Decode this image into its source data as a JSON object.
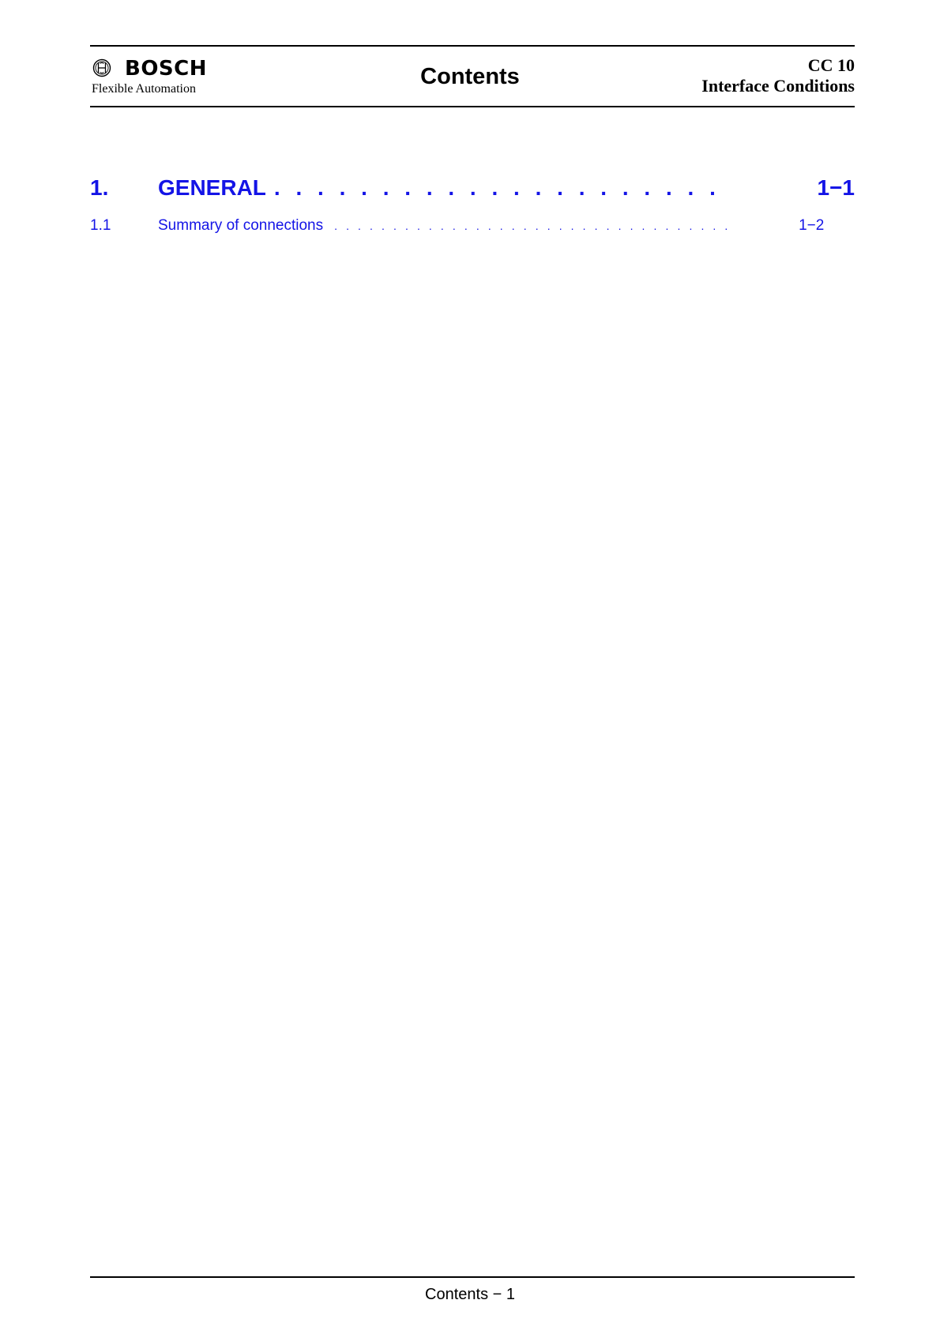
{
  "header": {
    "brand": "BOSCH",
    "brand_sub": "Flexible Automation",
    "logo_icon": "bosch-armature-icon",
    "title": "Contents",
    "product": "CC 10",
    "doc_title": "Interface Conditions"
  },
  "toc": [
    {
      "number": "1.",
      "title": "GENERAL",
      "leader": ". . . . . . . . . . . . . . . . . . . . . . . . . . . . . . . . . . . . . . . . . . . . . . .",
      "page": "1−1"
    },
    {
      "number": "1.1",
      "title": "Summary of connections",
      "leader": ". . . . . . . . . . . . . . . . . . . . . . . . . . . . . . . . . . . . . . . . . . . . . . . . . . . . . . . . . . . . . . . . . . . . . .",
      "page": "1−2"
    }
  ],
  "footer": {
    "page_label": "Contents  −  1"
  },
  "colors": {
    "toc_link": "#1414e6",
    "text": "#000000"
  }
}
